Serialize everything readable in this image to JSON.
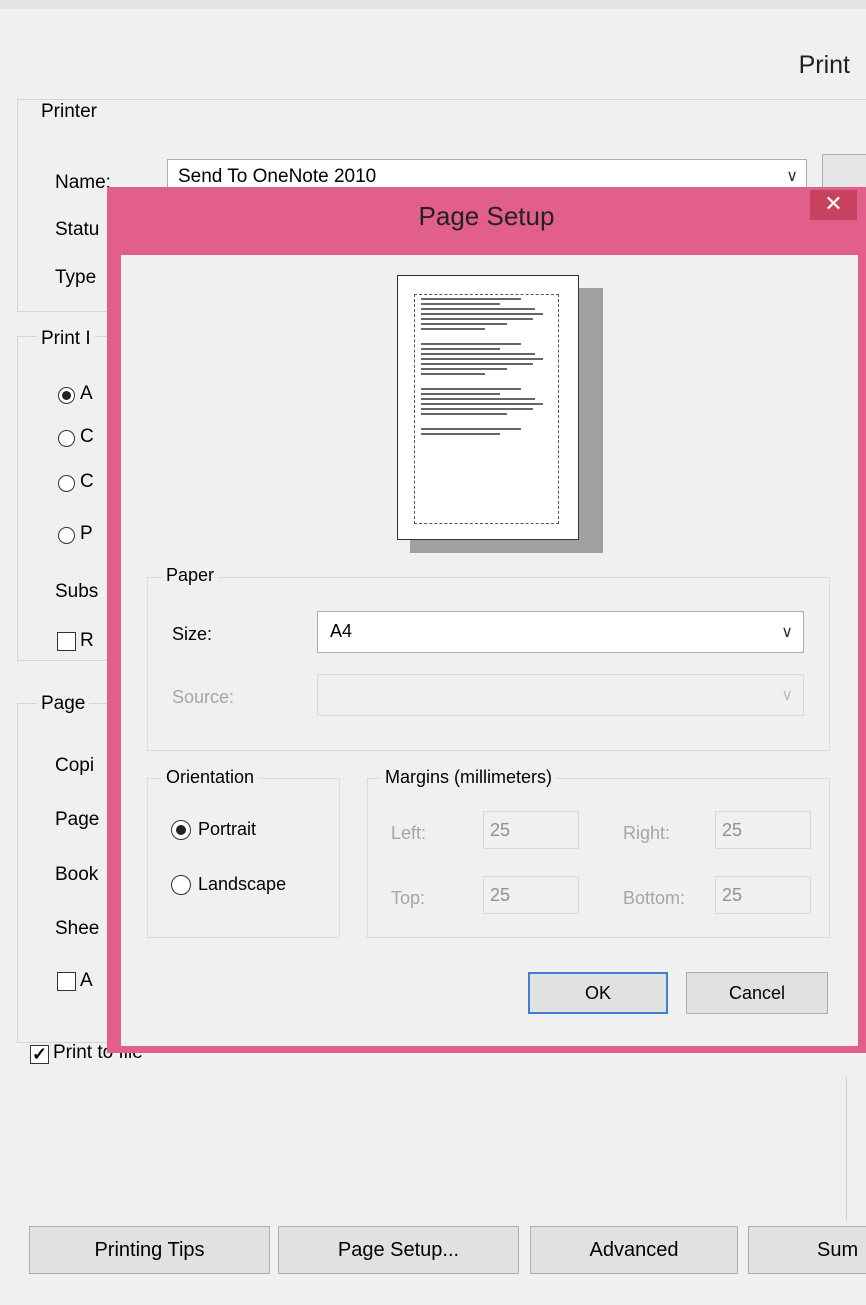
{
  "print_dialog": {
    "title": "Print",
    "printer_group_label": "Printer",
    "name_label": "Name:",
    "name_value": "Send To OneNote 2010",
    "status_label": "Statu",
    "type_label": "Type",
    "print_range_label": "Print I",
    "radio_all_label": "A",
    "radio_2_label": "C",
    "radio_3_label": "C",
    "radio_4_label": "P",
    "subset_label": "Subs",
    "reverse_label": "R",
    "page_group_label": "Page",
    "copies_label": "Copi",
    "pages_label": "Page",
    "booklet_label": "Book",
    "sheets_label": "Shee",
    "a_checkbox_label": "A",
    "print_to_file_label": "Print to file",
    "buttons": {
      "printing_tips": "Printing Tips",
      "page_setup": "Page Setup...",
      "advanced": "Advanced",
      "summary": "Sum"
    }
  },
  "page_setup": {
    "title": "Page Setup",
    "close": "✕",
    "paper": {
      "group_label": "Paper",
      "size_label": "Size:",
      "size_value": "A4",
      "source_label": "Source:",
      "source_value": ""
    },
    "orientation": {
      "group_label": "Orientation",
      "portrait": "Portrait",
      "landscape": "Landscape",
      "selected": "Portrait"
    },
    "margins": {
      "group_label": "Margins (millimeters)",
      "left_label": "Left:",
      "left_value": "25",
      "right_label": "Right:",
      "right_value": "25",
      "top_label": "Top:",
      "top_value": "25",
      "bottom_label": "Bottom:",
      "bottom_value": "25"
    },
    "ok": "OK",
    "cancel": "Cancel"
  },
  "icons": {
    "dropdown": "chevron-down-icon",
    "close": "close-icon",
    "check": "checkmark-icon"
  },
  "colors": {
    "dialog_frame": "#e25f8a",
    "close_button": "#c8415e",
    "default_button_border": "#3c7fd1"
  }
}
